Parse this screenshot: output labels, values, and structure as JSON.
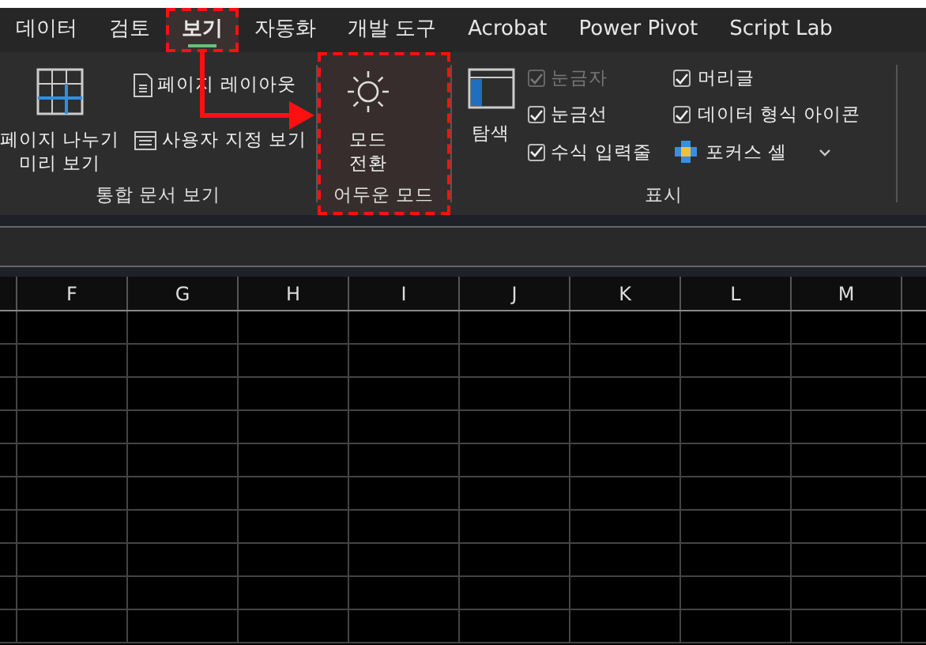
{
  "tabs": [
    {
      "label": "데이터",
      "selected": false,
      "highlighted": false
    },
    {
      "label": "검토",
      "selected": false,
      "highlighted": false
    },
    {
      "label": "보기",
      "selected": true,
      "highlighted": true
    },
    {
      "label": "자동화",
      "selected": false,
      "highlighted": false
    },
    {
      "label": "개발 도구",
      "selected": false,
      "highlighted": false
    },
    {
      "label": "Acrobat",
      "selected": false,
      "highlighted": false
    },
    {
      "label": "Power Pivot",
      "selected": false,
      "highlighted": false
    },
    {
      "label": "Script Lab",
      "selected": false,
      "highlighted": false
    }
  ],
  "ribbon_groups": [
    {
      "label": "통합 문서 보기",
      "highlighted": false,
      "items": [
        {
          "kind": "large",
          "label": "페이지 나누기 미리 보기"
        },
        {
          "kind": "small",
          "label": "페이지 레이아웃"
        },
        {
          "kind": "small",
          "label": "사용자 지정 보기"
        }
      ]
    },
    {
      "label": "어두운 모드",
      "highlighted": true,
      "items": [
        {
          "kind": "large",
          "label": "모드 전환"
        }
      ]
    },
    {
      "label": "표시",
      "highlighted": false,
      "items": [
        {
          "kind": "large",
          "label": "탐색"
        },
        {
          "kind": "check",
          "label": "눈금자",
          "checked": true,
          "disabled": true
        },
        {
          "kind": "check",
          "label": "눈금선",
          "checked": true,
          "disabled": false
        },
        {
          "kind": "check",
          "label": "수식 입력줄",
          "checked": true,
          "disabled": false
        },
        {
          "kind": "check",
          "label": "머리글",
          "checked": true,
          "disabled": false
        },
        {
          "kind": "check",
          "label": "데이터 형식 아이콘",
          "checked": true,
          "disabled": false
        },
        {
          "kind": "focus",
          "label": "포커스 셀"
        }
      ]
    }
  ],
  "columns": [
    "F",
    "G",
    "H",
    "I",
    "J",
    "K",
    "L",
    "M"
  ]
}
